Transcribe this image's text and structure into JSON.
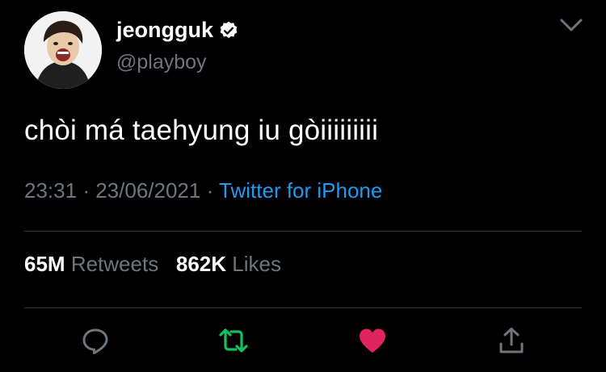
{
  "user": {
    "display_name": "jeongguk",
    "handle": "@playboy",
    "verified_icon": "verified-badge-icon"
  },
  "tweet": {
    "text": "chòi má taehyung iu gòiiiiiiiii",
    "time": "23:31",
    "separator": "·",
    "date": "23/06/2021",
    "source": "Twitter for iPhone"
  },
  "stats": {
    "retweets_count": "65M",
    "retweets_label": "Retweets",
    "likes_count": "862K",
    "likes_label": "Likes"
  },
  "actions": [
    {
      "icon": "reply-icon"
    },
    {
      "icon": "retweet-icon",
      "color": "#17bf63"
    },
    {
      "icon": "like-icon",
      "color": "#e0245e"
    },
    {
      "icon": "share-icon"
    }
  ],
  "colors": {
    "background": "#000000",
    "muted": "#6e767d",
    "link": "#1d9bf0",
    "retweet": "#17bf63",
    "like": "#e0245e"
  }
}
